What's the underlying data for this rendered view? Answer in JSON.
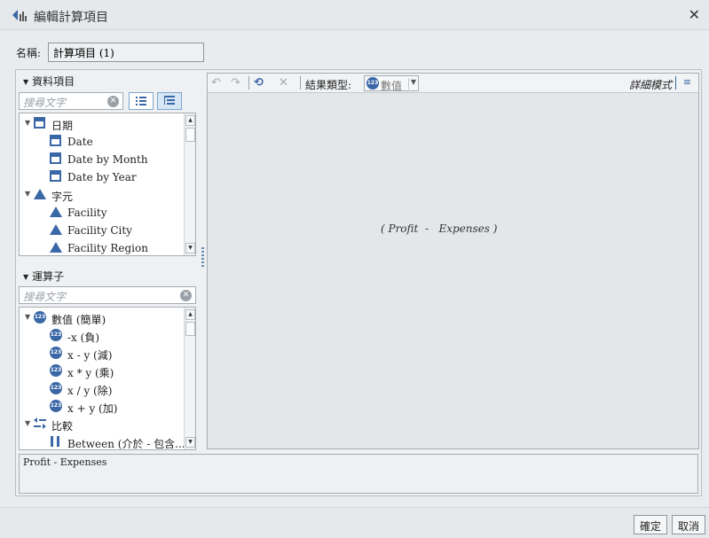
{
  "dialog": {
    "title": "編輯計算項目",
    "close_glyph": "✕"
  },
  "name_field": {
    "label": "名稱:",
    "value": "計算項目 (1)"
  },
  "data_items": {
    "header": "資料項目",
    "search_placeholder": "搜尋文字",
    "tree": [
      {
        "label": "日期",
        "type": "group",
        "icon": "calendar-icon"
      },
      {
        "label": "Date",
        "type": "leaf",
        "icon": "calendar-icon"
      },
      {
        "label": "Date by Month",
        "type": "leaf",
        "icon": "calendar-icon"
      },
      {
        "label": "Date by Year",
        "type": "leaf",
        "icon": "calendar-icon"
      },
      {
        "label": "字元",
        "type": "group",
        "icon": "character-icon"
      },
      {
        "label": "Facility",
        "type": "leaf",
        "icon": "character-icon"
      },
      {
        "label": "Facility City",
        "type": "leaf",
        "icon": "character-icon"
      },
      {
        "label": "Facility Region",
        "type": "leaf",
        "icon": "character-icon"
      }
    ]
  },
  "operators": {
    "header": "運算子",
    "search_placeholder": "搜尋文字",
    "tree": [
      {
        "label": "數值 (簡單)",
        "type": "group",
        "icon": "numeric-icon"
      },
      {
        "label": "-x (負)",
        "type": "leaf",
        "icon": "numeric-icon"
      },
      {
        "label": "x - y (減)",
        "type": "leaf",
        "icon": "numeric-icon"
      },
      {
        "label": "x * y (乘)",
        "type": "leaf",
        "icon": "numeric-icon"
      },
      {
        "label": "x / y (除)",
        "type": "leaf",
        "icon": "numeric-icon"
      },
      {
        "label": "x + y (加)",
        "type": "leaf",
        "icon": "numeric-icon"
      },
      {
        "label": "比較",
        "type": "group",
        "icon": "comparison-icon"
      },
      {
        "label": "Between (介於 - 包含...",
        "type": "leaf",
        "icon": "between-icon"
      }
    ]
  },
  "editor": {
    "result_type_label": "結果類型:",
    "result_type_value": "數值",
    "detail_mode": "詳細模式",
    "expression": "( Profit  -   Expenses )"
  },
  "preview_text": "Profit - Expenses",
  "buttons": {
    "ok": "確定",
    "cancel": "取消"
  },
  "colors": {
    "accent": "#3a67a6",
    "background": "#e9ecef"
  }
}
